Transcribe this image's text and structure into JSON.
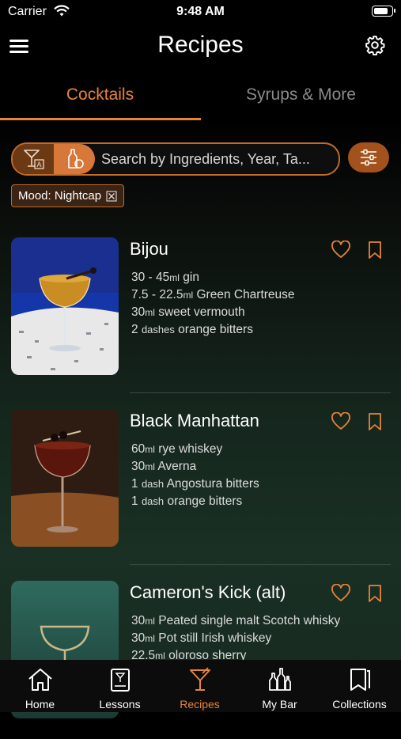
{
  "status_bar": {
    "carrier": "Carrier",
    "time": "9:48 AM",
    "battery_level": 0.85
  },
  "header": {
    "title": "Recipes"
  },
  "tabs": [
    {
      "label": "Cocktails",
      "active": true
    },
    {
      "label": "Syrups & More",
      "active": false
    }
  ],
  "search": {
    "placeholder": "Search by Ingredients, Year, Ta..."
  },
  "filter_chip": {
    "label": "Mood: Nightcap"
  },
  "recipes": [
    {
      "name": "Bijou",
      "ingredients": [
        {
          "amount": "30 - 45",
          "unit": "ml",
          "item": "gin"
        },
        {
          "amount": "7.5 - 22.5",
          "unit": "ml",
          "item": "Green Chartreuse"
        },
        {
          "amount": "30",
          "unit": "ml",
          "item": "sweet vermouth"
        },
        {
          "amount": "2",
          "unit": "dashes",
          "item": "orange bitters"
        }
      ]
    },
    {
      "name": "Black Manhattan",
      "ingredients": [
        {
          "amount": "60",
          "unit": "ml",
          "item": "rye whiskey"
        },
        {
          "amount": "30",
          "unit": "ml",
          "item": "Averna"
        },
        {
          "amount": "1",
          "unit": "dash",
          "item": "Angostura bitters"
        },
        {
          "amount": "1",
          "unit": "dash",
          "item": "orange bitters"
        }
      ]
    },
    {
      "name": "Cameron's Kick (alt)",
      "ingredients": [
        {
          "amount": "30",
          "unit": "ml",
          "item": "Peated single malt Scotch whisky"
        },
        {
          "amount": "30",
          "unit": "ml",
          "item": "Pot still Irish whiskey"
        },
        {
          "amount": "22.5",
          "unit": "ml",
          "item": "oloroso sherry"
        }
      ]
    }
  ],
  "tab_bar": [
    {
      "label": "Home",
      "icon": "home-icon",
      "active": false
    },
    {
      "label": "Lessons",
      "icon": "lessons-icon",
      "active": false
    },
    {
      "label": "Recipes",
      "icon": "cocktail-glass-icon",
      "active": true
    },
    {
      "label": "My Bar",
      "icon": "bottles-icon",
      "active": false
    },
    {
      "label": "Collections",
      "icon": "collections-icon",
      "active": false
    }
  ],
  "colors": {
    "accent": "#e8833a",
    "background": "#0f1a14"
  }
}
